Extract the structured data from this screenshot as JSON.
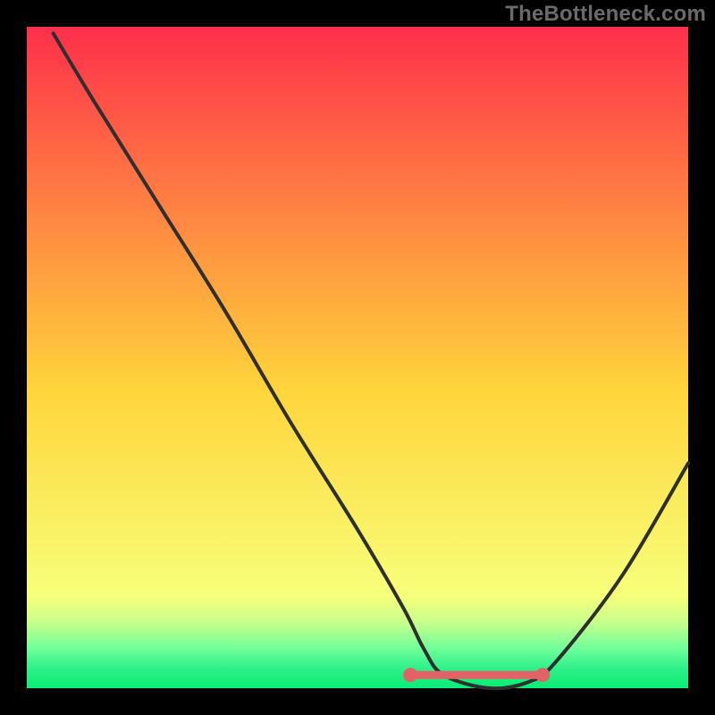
{
  "watermark": "TheBottleneck.com",
  "colors": {
    "gradient_top": "#ff2f4a",
    "gradient_mid": "#ffd53b",
    "gradient_bottom_band_1": "#f7ff7a",
    "gradient_bottom_band_2": "#c8ff8a",
    "gradient_bottom_band_3": "#70ff9a",
    "gradient_bottom_band_4": "#2ef08a",
    "gradient_bottom_final": "#0aee72",
    "background": "#000000",
    "line": "#2f2f2f",
    "optimal_dot_fill": "#e16368",
    "optimal_dot_stroke": "#e16368",
    "optimal_line": "#e16368"
  },
  "chart_data": {
    "type": "line",
    "title": "",
    "xlabel": "",
    "ylabel": "",
    "xlim": [
      0,
      100
    ],
    "ylim": [
      0,
      100
    ],
    "x": [
      4,
      10,
      20,
      30,
      40,
      50,
      57,
      60,
      63,
      70,
      76,
      80,
      90,
      100
    ],
    "values": [
      99,
      89,
      73,
      57,
      40,
      24,
      12,
      6,
      2,
      0,
      1,
      4,
      17,
      34
    ],
    "optimal_range_x": [
      58,
      78
    ],
    "optimal_range_y": 2,
    "annotations": []
  }
}
